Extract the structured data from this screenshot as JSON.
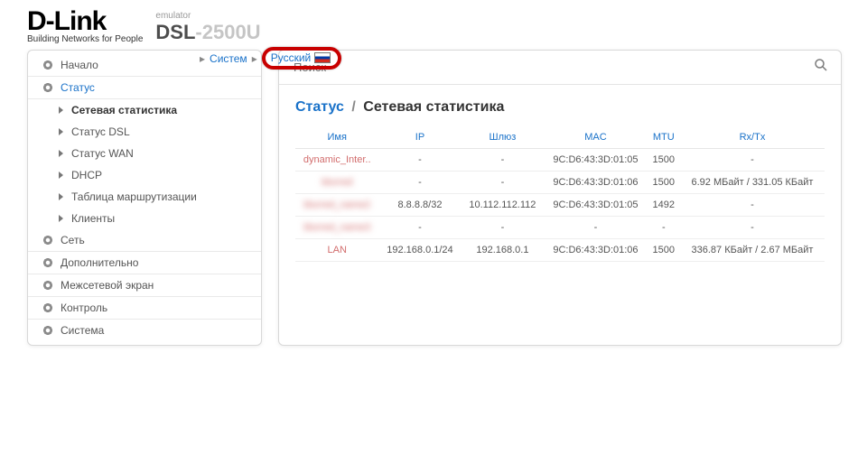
{
  "header": {
    "brand": "D-Link",
    "slogan": "Building Networks for People",
    "emulator_label": "emulator",
    "model_prefix": "DSL",
    "model_suffix": "-2500U",
    "crumb_system": "Систем",
    "lang_label": "Русский"
  },
  "search": {
    "placeholder": "Поиск"
  },
  "sidebar": {
    "items": [
      {
        "label": "Начало",
        "type": "top"
      },
      {
        "label": "Статус",
        "type": "top",
        "active": true
      },
      {
        "label": "Сетевая статистика",
        "type": "sub",
        "bold": true
      },
      {
        "label": "Статус DSL",
        "type": "sub"
      },
      {
        "label": "Статус WAN",
        "type": "sub"
      },
      {
        "label": "DHCP",
        "type": "sub"
      },
      {
        "label": "Таблица маршрутизации",
        "type": "sub"
      },
      {
        "label": "Клиенты",
        "type": "sub"
      },
      {
        "label": "Сеть",
        "type": "top"
      },
      {
        "label": "Дополнительно",
        "type": "top"
      },
      {
        "label": "Межсетевой экран",
        "type": "top"
      },
      {
        "label": "Контроль",
        "type": "top"
      },
      {
        "label": "Система",
        "type": "top"
      }
    ]
  },
  "page": {
    "crumb_root": "Статус",
    "crumb_sep": "/",
    "crumb_current": "Сетевая статистика",
    "columns": {
      "name": "Имя",
      "ip": "IP",
      "gw": "Шлюз",
      "mac": "MAC",
      "mtu": "MTU",
      "rxtx": "Rx/Tx"
    },
    "rows": [
      {
        "name": "dynamic_Inter..",
        "ip": "-",
        "gw": "-",
        "mac": "9C:D6:43:3D:01:05",
        "mtu": "1500",
        "rxtx": "-",
        "blur": false
      },
      {
        "name": "blurred",
        "ip": "-",
        "gw": "-",
        "mac": "9C:D6:43:3D:01:06",
        "mtu": "1500",
        "rxtx": "6.92 МБайт / 331.05 КБайт",
        "blur": true
      },
      {
        "name": "blurred_name2",
        "ip": "8.8.8.8/32",
        "gw": "10.112.112.112",
        "mac": "9C:D6:43:3D:01:05",
        "mtu": "1492",
        "rxtx": "-",
        "blur": true
      },
      {
        "name": "blurred_name3",
        "ip": "-",
        "gw": "-",
        "mac": "-",
        "mtu": "-",
        "rxtx": "-",
        "blur": true
      },
      {
        "name": "LAN",
        "ip": "192.168.0.1/24",
        "gw": "192.168.0.1",
        "mac": "9C:D6:43:3D:01:06",
        "mtu": "1500",
        "rxtx": "336.87 КБайт / 2.67 МБайт",
        "blur": false
      }
    ]
  }
}
